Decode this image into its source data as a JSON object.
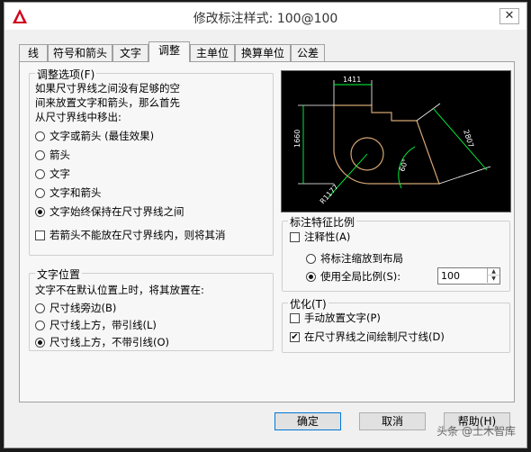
{
  "window": {
    "title": "修改标注样式: 100@100",
    "close_glyph": "✕"
  },
  "tabs": [
    {
      "label": "线",
      "active": false
    },
    {
      "label": "符号和箭头",
      "active": false
    },
    {
      "label": "文字",
      "active": false
    },
    {
      "label": "调整",
      "active": true
    },
    {
      "label": "主单位",
      "active": false
    },
    {
      "label": "换算单位",
      "active": false
    },
    {
      "label": "公差",
      "active": false
    }
  ],
  "fit": {
    "legend": "调整选项(F)",
    "desc": [
      "如果尺寸界线之间没有足够的空",
      "间来放置文字和箭头，那么首先",
      "从尺寸界线中移出:"
    ],
    "options": [
      {
        "label": "文字或箭头 (最佳效果)",
        "selected": false
      },
      {
        "label": "箭头",
        "selected": false
      },
      {
        "label": "文字",
        "selected": false
      },
      {
        "label": "文字和箭头",
        "selected": false
      },
      {
        "label": "文字始终保持在尺寸界线之间",
        "selected": true
      }
    ],
    "suppress": {
      "label": "若箭头不能放在尺寸界线内，则将其消",
      "checked": false
    }
  },
  "text_placement": {
    "legend": "文字位置",
    "desc": "文字不在默认位置上时，将其放置在:",
    "options": [
      {
        "label": "尺寸线旁边(B)",
        "selected": false
      },
      {
        "label": "尺寸线上方，带引线(L)",
        "selected": false
      },
      {
        "label": "尺寸线上方，不带引线(O)",
        "selected": true
      }
    ]
  },
  "preview": {
    "dims": [
      "1411",
      "1660",
      "2807",
      "60°",
      "R1177"
    ]
  },
  "scale": {
    "legend": "标注特征比例",
    "annotative": {
      "label": "注释性(A)",
      "checked": false
    },
    "layout": {
      "label": "将标注缩放到布局",
      "selected": false
    },
    "overall": {
      "label": "使用全局比例(S):",
      "selected": true
    },
    "value": "100"
  },
  "fine_tuning": {
    "legend": "优化(T)",
    "manual": {
      "label": "手动放置文字(P)",
      "checked": false
    },
    "draw_line": {
      "label": "在尺寸界线之间绘制尺寸线(D)",
      "checked": true
    }
  },
  "buttons": {
    "ok": "确定",
    "cancel": "取消",
    "help": "帮助(H)"
  },
  "watermark": "头条 @土木智库"
}
